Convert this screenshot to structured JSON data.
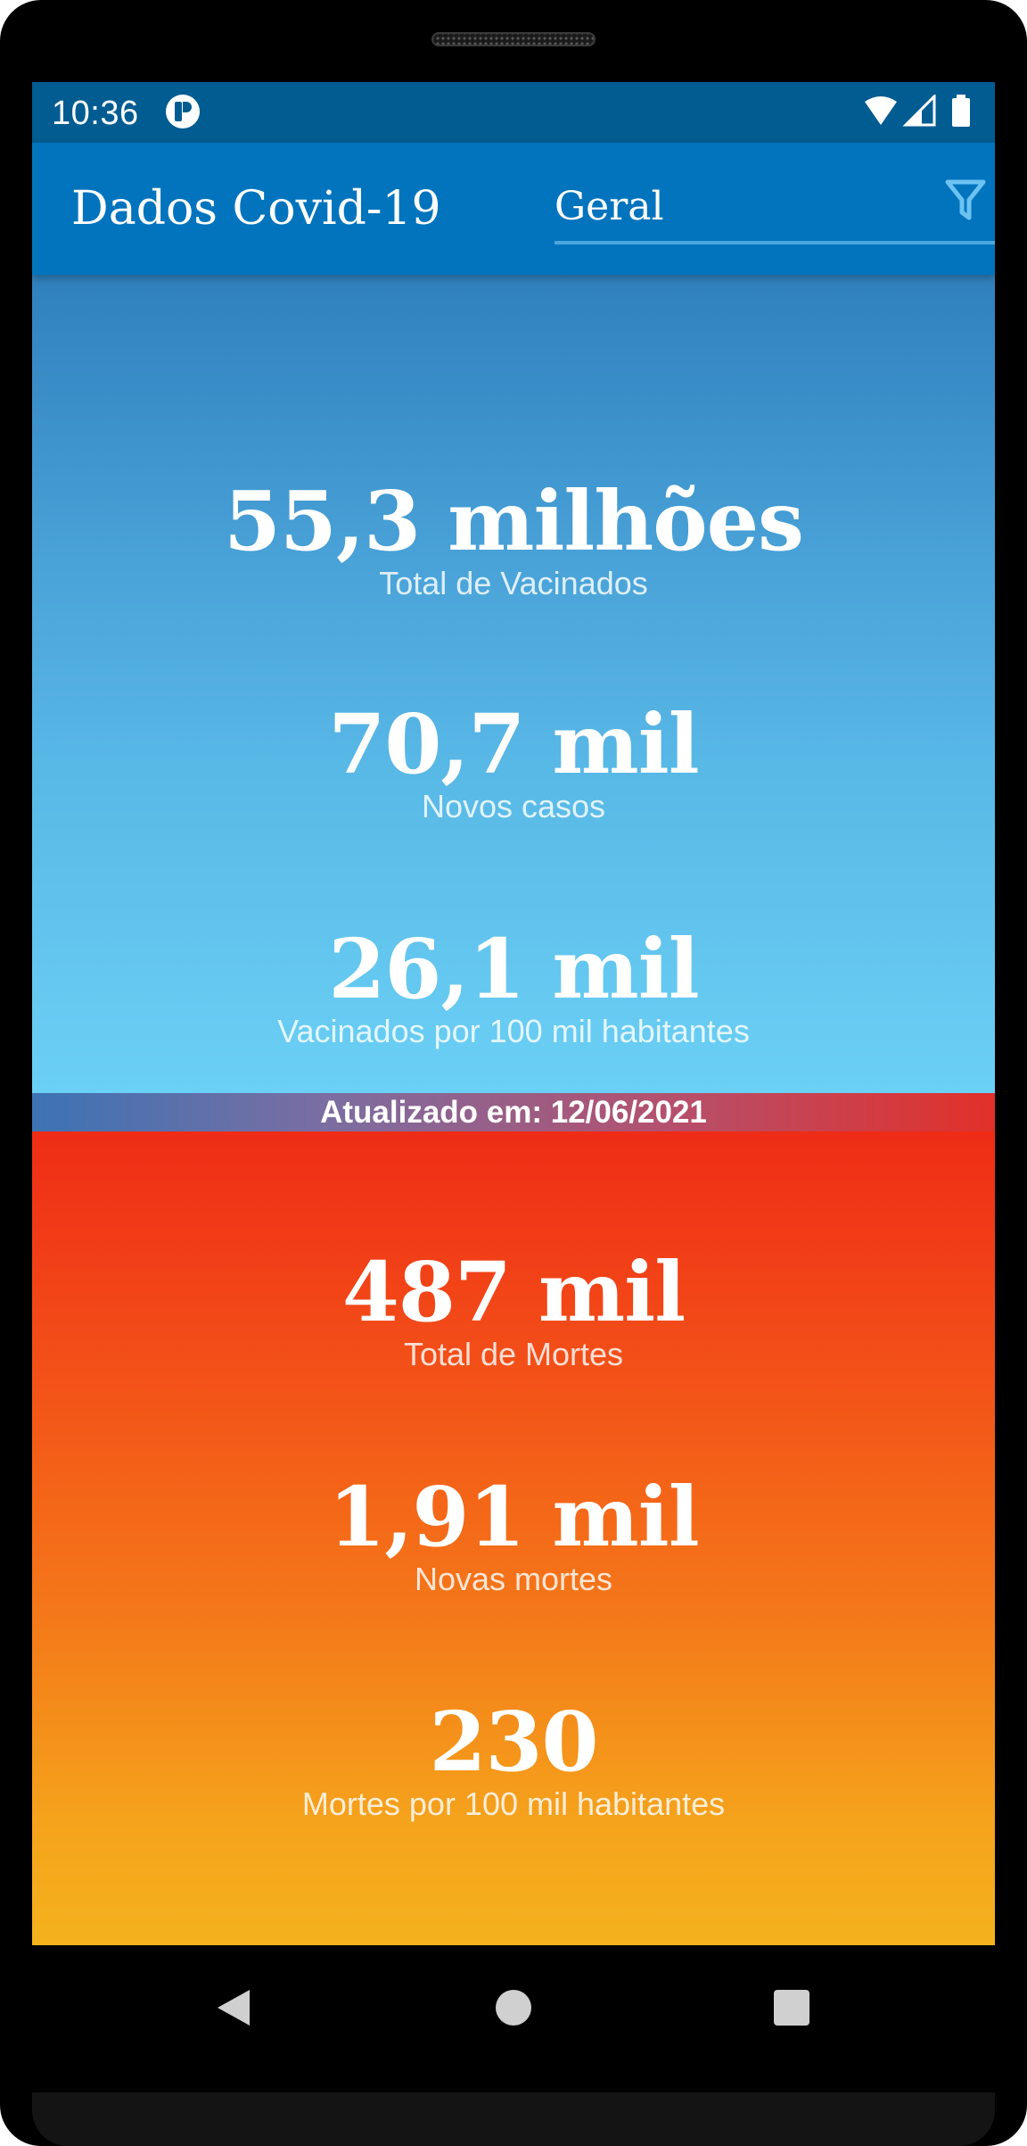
{
  "status_bar": {
    "time": "10:36",
    "icons": [
      "app-notification-icon",
      "wifi-icon",
      "signal-icon",
      "battery-icon"
    ]
  },
  "app_bar": {
    "title": "Dados Covid-19",
    "filter": {
      "value": "Geral",
      "icon": "filter-icon"
    }
  },
  "vaccination": {
    "stats": [
      {
        "value": "55,3 milhões",
        "label": "Total de Vacinados"
      },
      {
        "value": "70,7 mil",
        "label": "Novos casos"
      },
      {
        "value": "26,1 mil",
        "label": "Vacinados por 100 mil habitantes"
      }
    ]
  },
  "updated": {
    "text": "Atualizado em: 12/06/2021"
  },
  "deaths": {
    "stats": [
      {
        "value": "487 mil",
        "label": "Total de Mortes"
      },
      {
        "value": "1,91 mil",
        "label": "Novas mortes"
      },
      {
        "value": "230",
        "label": "Mortes por 100 mil habitantes"
      }
    ]
  },
  "nav_bar": {
    "buttons": [
      "back-icon",
      "home-icon",
      "recents-icon"
    ]
  },
  "colors": {
    "status_bar": "#005c91",
    "app_bar": "#0274bd",
    "blue_top": "#2f80bd",
    "blue_bottom": "#6bd0f5",
    "red_top": "#ef2c16",
    "orange_bottom": "#f5b21d"
  }
}
